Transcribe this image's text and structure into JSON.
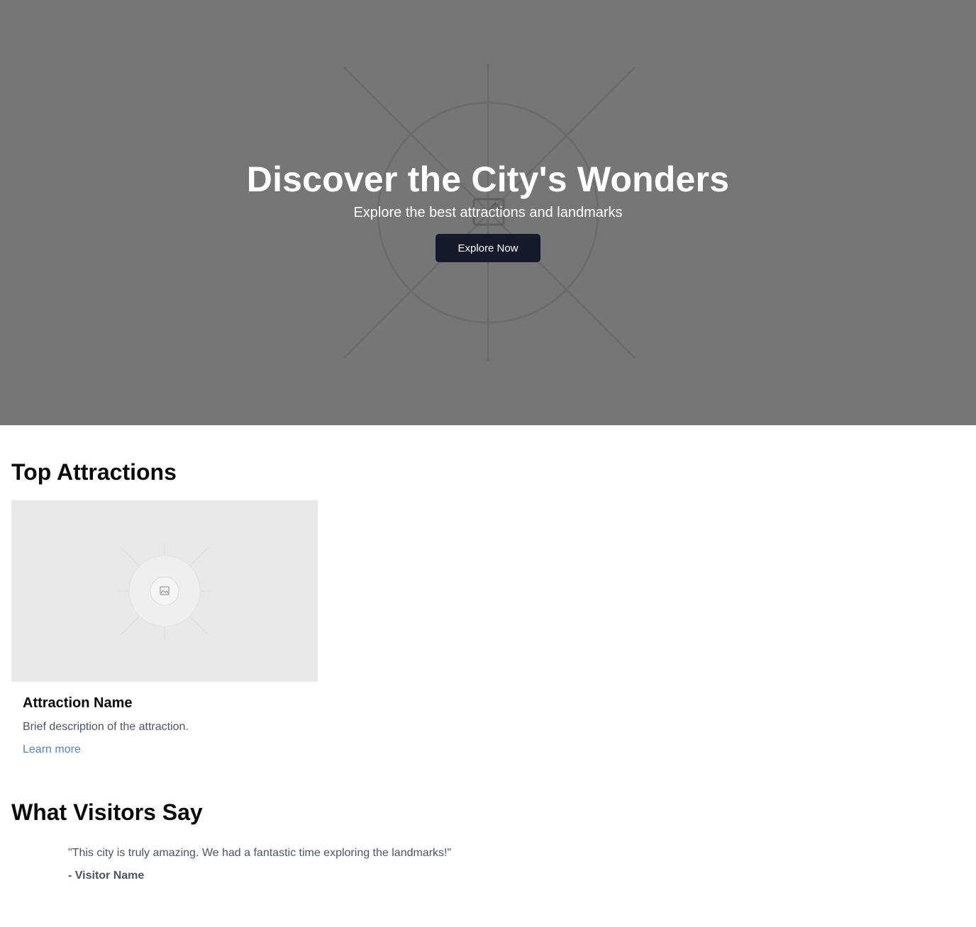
{
  "hero": {
    "title": "Discover the City's Wonders",
    "subtitle": "Explore the best attractions and landmarks",
    "button_label": "Explore Now",
    "background_color": "#767676",
    "button_color": "#141a2a",
    "image_icon": "image-placeholder-icon"
  },
  "attractions": {
    "heading": "Top Attractions",
    "cards": [
      {
        "title": "Attraction Name",
        "description": "Brief description of the attraction.",
        "link_label": "Learn more",
        "image_icon": "image-placeholder-icon"
      }
    ]
  },
  "testimonials": {
    "heading": "What Visitors Say",
    "items": [
      {
        "quote": "\"This city is truly amazing. We had a fantastic time exploring the landmarks!\"",
        "author": "- Visitor Name"
      }
    ]
  },
  "colors": {
    "link": "#4a86c8",
    "muted_text": "#4b5563",
    "placeholder_bg": "#e9e9e9"
  }
}
